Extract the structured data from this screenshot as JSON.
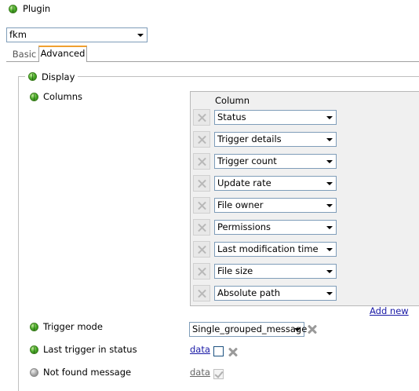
{
  "plugin": {
    "label": "Plugin",
    "select_value": "fkm"
  },
  "tabs": [
    {
      "label": "Basic",
      "active": false
    },
    {
      "label": "Advanced",
      "active": true
    }
  ],
  "display": {
    "legend": "Display"
  },
  "columns": {
    "label": "Columns",
    "header": "Column",
    "items": [
      "Status",
      "Trigger details",
      "Trigger count",
      "Update rate",
      "File owner",
      "Permissions",
      "Last modification time",
      "File size",
      "Absolute path"
    ],
    "add_new": "Add new"
  },
  "trigger_mode": {
    "label": "Trigger mode",
    "value": "Single_grouped_message"
  },
  "last_trigger": {
    "label": "Last trigger in status",
    "data_link": "data",
    "checked": false
  },
  "not_found": {
    "label": "Not found message",
    "data_link": "data",
    "checked": true
  },
  "colors": {
    "accent_tab": "#f0a030",
    "link": "#1a1aa6",
    "enabled": "#4caf2a",
    "disabled": "#a8a8a8"
  }
}
